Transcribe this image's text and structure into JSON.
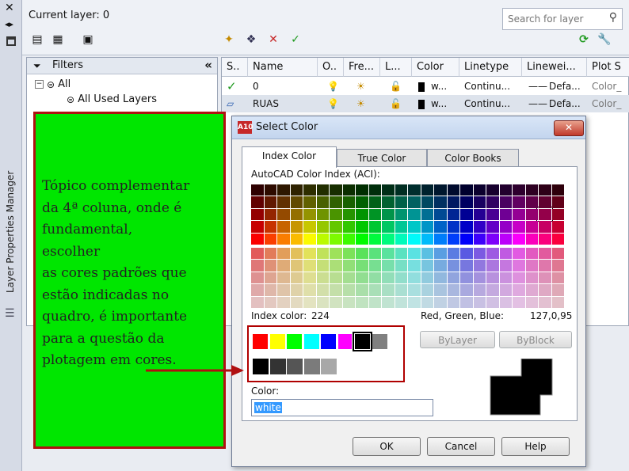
{
  "palette": {
    "title": "Layer Properties Manager"
  },
  "topbar": {
    "current_layer": "Current layer: 0",
    "search_placeholder": "Search for layer"
  },
  "filters": {
    "header": "Filters",
    "items": [
      {
        "label": "All"
      },
      {
        "label": "All Used Layers"
      }
    ]
  },
  "grid": {
    "columns": [
      "S..",
      "Name",
      "O..",
      "Fre...",
      "L...",
      "Color",
      "Linetype",
      "Linewei...",
      "Plot S"
    ],
    "rows": [
      {
        "name": "0",
        "color_label": "w...",
        "linetype": "Continu...",
        "lineweight": "Defa...",
        "plot": "Color_"
      },
      {
        "name": "RUAS",
        "color_label": "w...",
        "linetype": "Continu...",
        "lineweight": "Defa...",
        "plot": "Color_"
      }
    ]
  },
  "dialog": {
    "title": "Select Color",
    "icon_text": "A10",
    "tabs": [
      "Index Color",
      "True Color",
      "Color Books"
    ],
    "aci_label": "AutoCAD Color Index (ACI):",
    "index_color_label": "Index color:",
    "index_color_value": "224",
    "rgb_label": "Red, Green, Blue:",
    "rgb_value": "127,0,95",
    "bylayer_label": "ByLayer",
    "byblock_label": "ByBlock",
    "color_field_label": "Color:",
    "color_value": "white",
    "ok_label": "OK",
    "cancel_label": "Cancel",
    "help_label": "Help",
    "accent_color": "#b00000"
  },
  "callout": {
    "text_lines": [
      "Tópico complementar",
      "da 4ª coluna, onde é",
      "fundamental,",
      "escolher",
      "as cores padrões que",
      "estão indicadas no",
      "quadro, é importante",
      "para a questão da",
      "plotagem em cores."
    ]
  }
}
